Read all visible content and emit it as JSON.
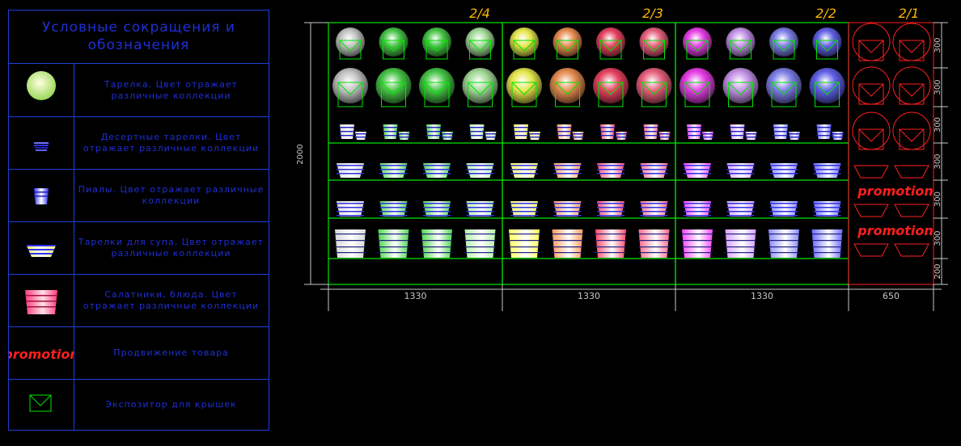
{
  "legend": {
    "title": "Условные  сокращения  и обозначения",
    "rows": [
      {
        "icon": "plate",
        "text": "Тарелка. Цвет отражает различные коллекции"
      },
      {
        "icon": "dessert-plates",
        "text": "Десертные тарелки. Цвет отражает различные коллекции"
      },
      {
        "icon": "cups",
        "text": "Пиалы. Цвет отражает различные коллекции"
      },
      {
        "icon": "soup-plates",
        "text": "Тарелки для супа. Цвет отражает различные коллекции"
      },
      {
        "icon": "salad-bowls",
        "text": "Салатники, блюда. Цвет отражает различные коллекции"
      },
      {
        "icon": "promotion",
        "text": "Продвижение товара"
      },
      {
        "icon": "lid-display",
        "text": "Экспозитор для крышек"
      }
    ],
    "promotion_word": "promotion"
  },
  "sections": [
    {
      "label": "2/4",
      "width": "1330",
      "colors": [
        "#d8d8d8",
        "#4ed84e",
        "#4ed84e",
        "#b4f0a8"
      ]
    },
    {
      "label": "2/3",
      "width": "1330",
      "colors": [
        "#ffff55",
        "#ff9a5a",
        "#ff4a6a",
        "#ff6a8a"
      ]
    },
    {
      "label": "2/2",
      "width": "1330",
      "colors": [
        "#ff44ff",
        "#d8a0ff",
        "#8a8aff",
        "#6a6aff"
      ]
    },
    {
      "label": "2/1",
      "width": "650",
      "colors": []
    }
  ],
  "dims": {
    "total_height": "2000",
    "right_column": [
      "300",
      "300",
      "300",
      "300",
      "300",
      "300",
      "200"
    ]
  },
  "promotion_labels": [
    "promotion",
    "promotion"
  ],
  "colors": {
    "legend_border": "#1e3fd8",
    "shelf_green": "#00e600",
    "promo_red": "#ff1e1e",
    "dim_grey": "#c8c8c8",
    "label_orange": "#ffb800"
  }
}
